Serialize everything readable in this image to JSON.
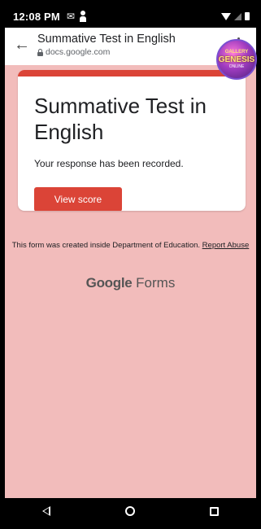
{
  "status_bar": {
    "time": "12:08 PM",
    "gmail_icon": "gmail-icon",
    "notification_icon": "person-icon"
  },
  "browser": {
    "title": "Summative Test in English",
    "url": "docs.google.com"
  },
  "overlay_badge": {
    "line1": "GALLERY",
    "line2": "GENESIS",
    "line3": "ONLINE"
  },
  "card": {
    "title": "Summative Test in English",
    "message": "Your response has been recorded.",
    "button_label": "View score"
  },
  "footer": {
    "created_text": "This form was created inside Department of Education.",
    "report_link": "Report Abuse",
    "brand_google": "Google",
    "brand_forms": "Forms"
  },
  "colors": {
    "accent": "#db4437",
    "background": "#f2bcbb"
  }
}
